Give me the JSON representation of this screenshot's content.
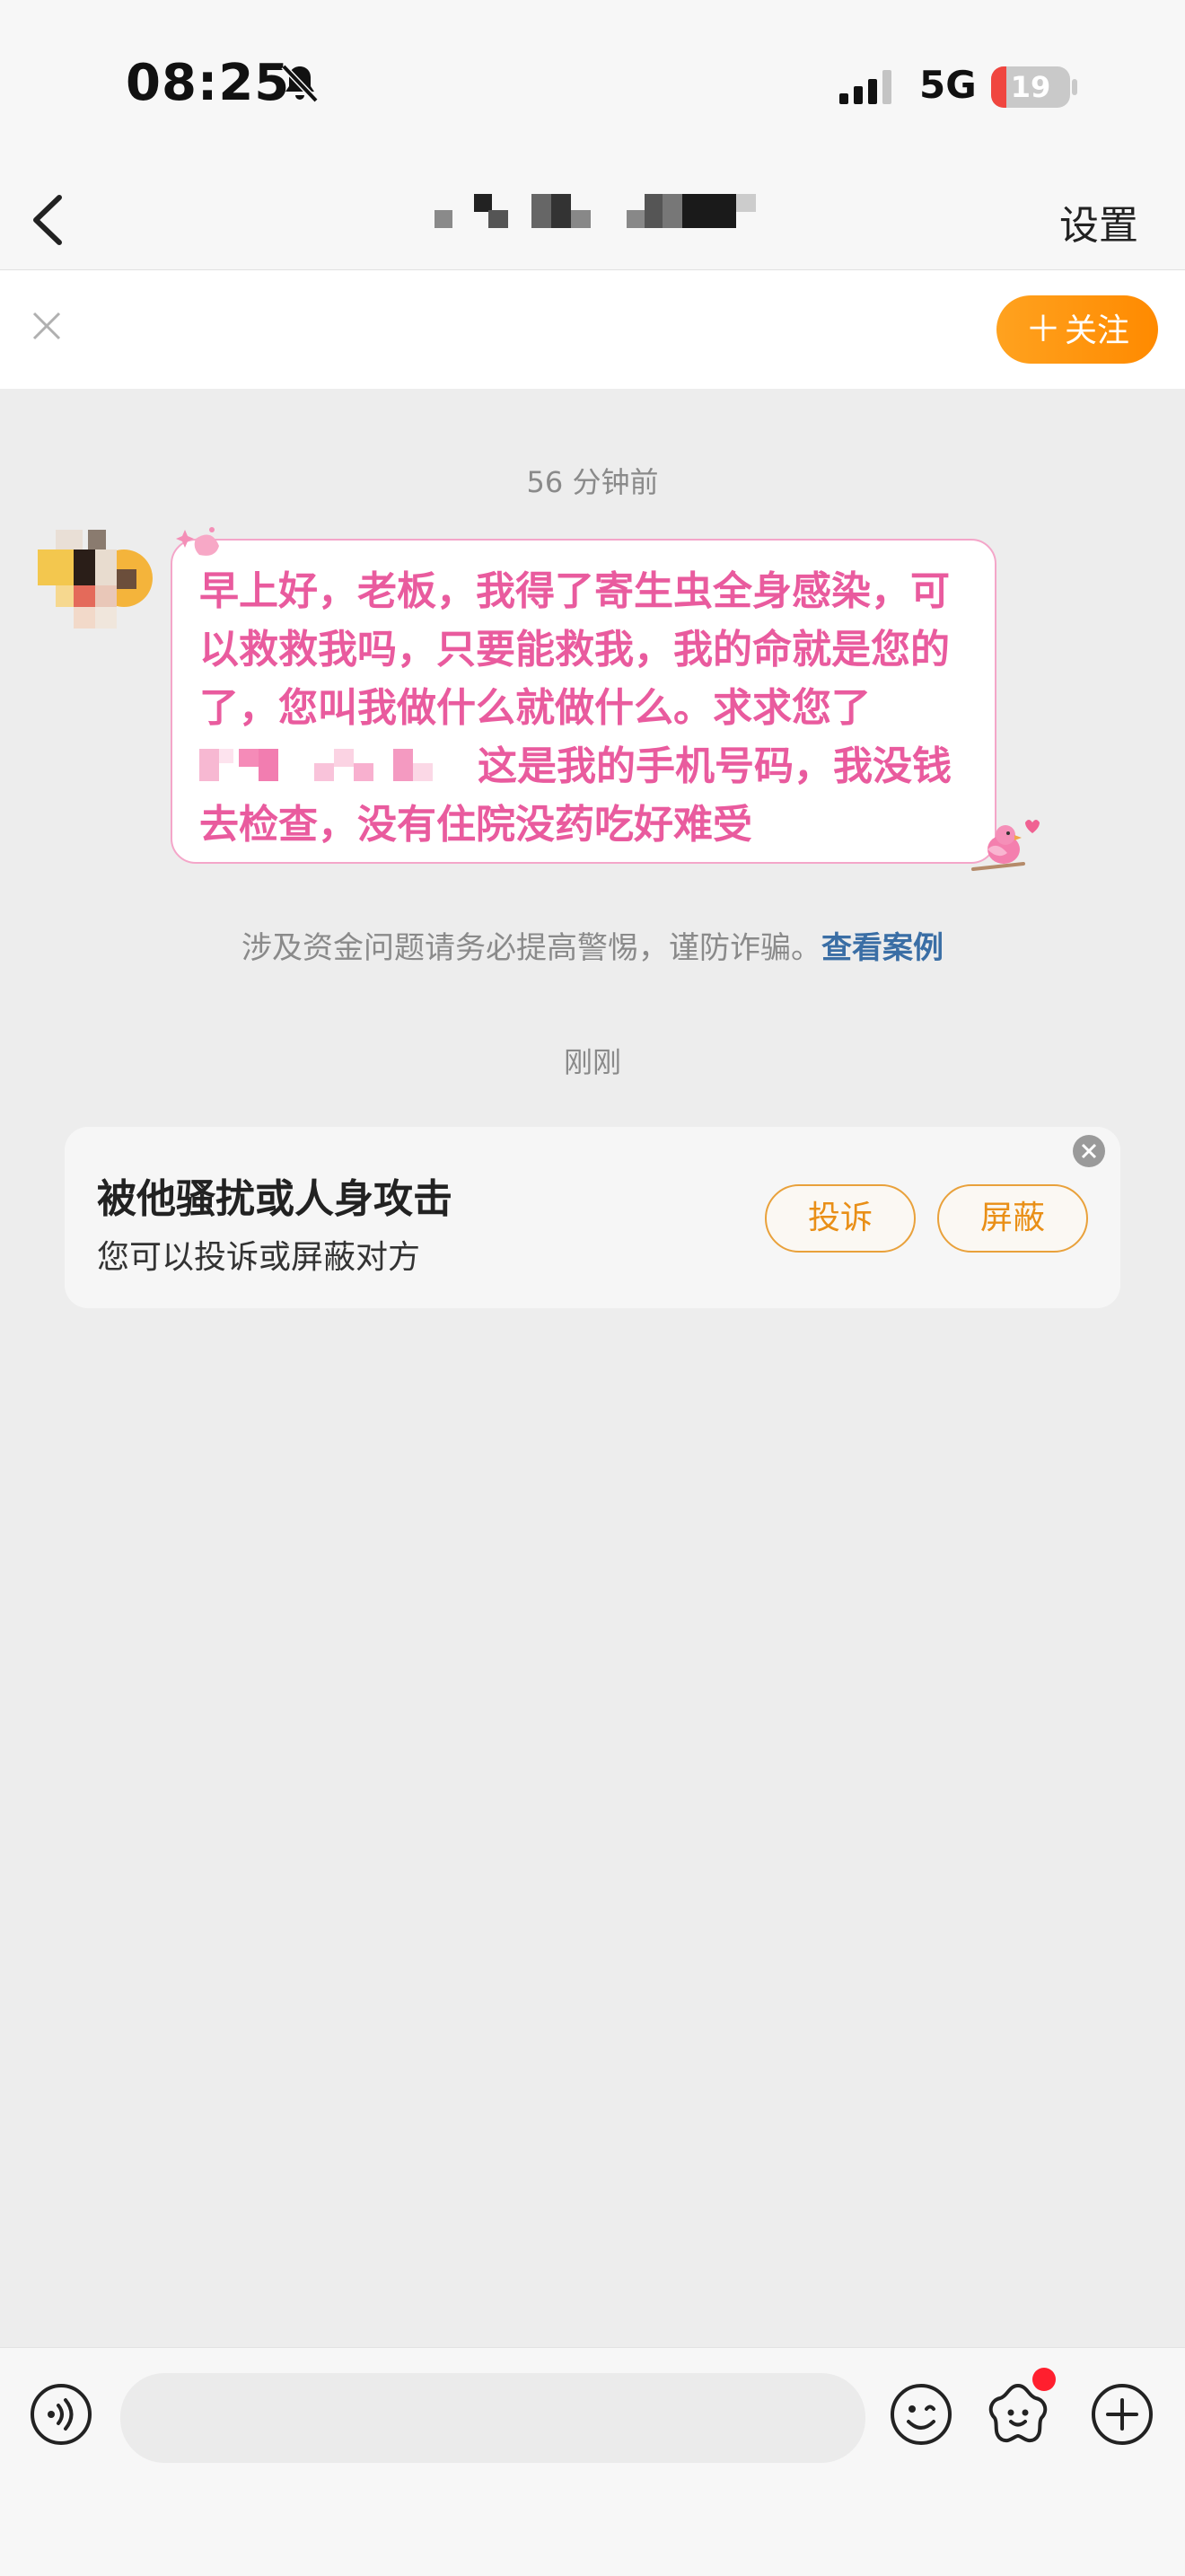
{
  "status_bar": {
    "time": "08:25",
    "network": "5G",
    "battery_level": "19",
    "battery_fraction": 0.19,
    "icons": [
      "bell-slash-icon",
      "signal-bars-icon",
      "battery-icon"
    ]
  },
  "header": {
    "title": "",
    "settings_label": "设置",
    "icons": [
      "back-chevron-icon"
    ]
  },
  "follow_bar": {
    "follow_label": "关注",
    "icons": [
      "close-icon",
      "plus-icon"
    ]
  },
  "chat": {
    "timestamp_1": "56 分钟前",
    "message": {
      "part1": "早上好，老板，我得了寄生虫全身感染，可以救救我吗，只要能救我，我的命就是您的了，您叫我做什么就做什么。求求您了",
      "part2": "这是我的手机号码，我没钱去检查，没有住院没药吃好难受"
    },
    "warning": {
      "text": "涉及资金问题请务必提高警惕，谨防诈骗。",
      "link": "查看案例"
    },
    "timestamp_2": "刚刚"
  },
  "harassment_card": {
    "title": "被他骚扰或人身攻击",
    "subtitle": "您可以投诉或屏蔽对方",
    "complain_label": "投诉",
    "block_label": "屏蔽"
  },
  "input_bar": {
    "placeholder": "",
    "icons": [
      "voice-icon",
      "emoji-icon",
      "sticker-icon",
      "plus-circle-icon"
    ]
  },
  "colors": {
    "accent_orange": "#ff8a00",
    "bubble_text_pink": "#e95b9e",
    "bubble_border_pink": "#f4a6c9",
    "link_blue": "#3a6ea5",
    "background": "#ededed"
  }
}
